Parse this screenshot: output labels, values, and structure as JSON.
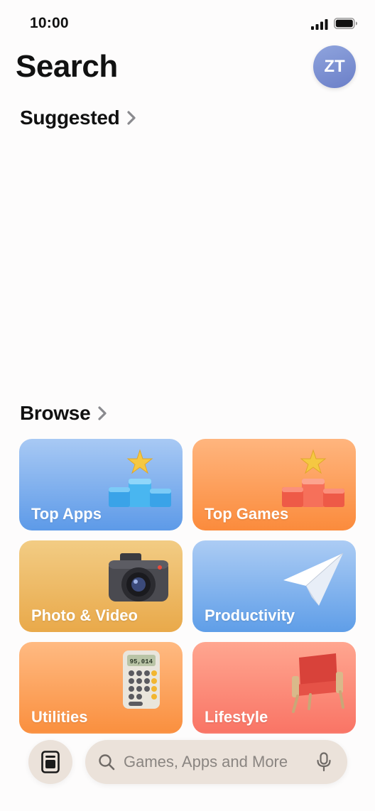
{
  "status_bar": {
    "time": "10:00"
  },
  "header": {
    "title": "Search",
    "avatar_initials": "ZT"
  },
  "sections": {
    "suggested": "Suggested",
    "browse": "Browse"
  },
  "browse_tiles": [
    {
      "label": "Top Apps",
      "icon": "podium-star-icon",
      "color": "#5d9ae8"
    },
    {
      "label": "Top Games",
      "icon": "podium-star-icon",
      "color": "#fb8b3c"
    },
    {
      "label": "Photo & Video",
      "icon": "camera-icon",
      "color": "#e9a94a"
    },
    {
      "label": "Productivity",
      "icon": "paper-plane-icon",
      "color": "#5f9ee8"
    },
    {
      "label": "Utilities",
      "icon": "calculator-icon",
      "color": "#fa8f3e",
      "display_value": "95,014"
    },
    {
      "label": "Lifestyle",
      "icon": "armchair-icon",
      "color": "#f97465"
    }
  ],
  "search": {
    "placeholder": "Games, Apps and More"
  }
}
